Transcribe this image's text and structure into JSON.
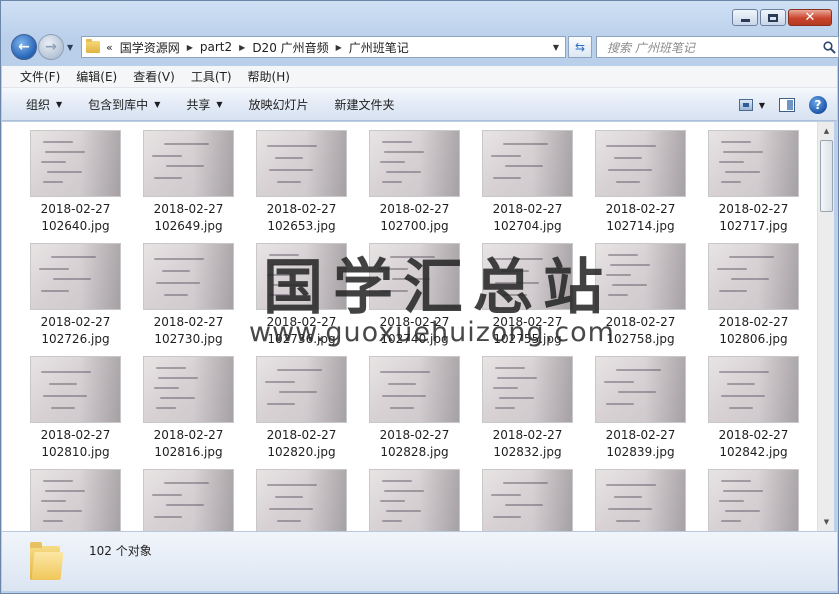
{
  "window": {
    "caption_buttons": [
      "minimize",
      "maximize",
      "close"
    ]
  },
  "nav": {
    "breadcrumbs": [
      "国学资源网",
      "part2",
      "D20 广州音频",
      "广州班笔记"
    ],
    "overflow_glyph": "«",
    "search_placeholder": "搜索 广州班笔记"
  },
  "menu": {
    "items": [
      "文件(F)",
      "编辑(E)",
      "查看(V)",
      "工具(T)",
      "帮助(H)"
    ]
  },
  "commands": {
    "organize": "组织",
    "include_library": "包含到库中",
    "share": "共享",
    "slideshow": "放映幻灯片",
    "new_folder": "新建文件夹"
  },
  "files": [
    {
      "date": "2018-02-27",
      "name": "102640.jpg"
    },
    {
      "date": "2018-02-27",
      "name": "102649.jpg"
    },
    {
      "date": "2018-02-27",
      "name": "102653.jpg"
    },
    {
      "date": "2018-02-27",
      "name": "102700.jpg"
    },
    {
      "date": "2018-02-27",
      "name": "102704.jpg"
    },
    {
      "date": "2018-02-27",
      "name": "102714.jpg"
    },
    {
      "date": "2018-02-27",
      "name": "102717.jpg"
    },
    {
      "date": "2018-02-27",
      "name": "102726.jpg"
    },
    {
      "date": "2018-02-27",
      "name": "102730.jpg"
    },
    {
      "date": "2018-02-27",
      "name": "102736.jpg"
    },
    {
      "date": "2018-02-27",
      "name": "102740.jpg"
    },
    {
      "date": "2018-02-27",
      "name": "102755.jpg"
    },
    {
      "date": "2018-02-27",
      "name": "102758.jpg"
    },
    {
      "date": "2018-02-27",
      "name": "102806.jpg"
    },
    {
      "date": "2018-02-27",
      "name": "102810.jpg"
    },
    {
      "date": "2018-02-27",
      "name": "102816.jpg"
    },
    {
      "date": "2018-02-27",
      "name": "102820.jpg"
    },
    {
      "date": "2018-02-27",
      "name": "102828.jpg"
    },
    {
      "date": "2018-02-27",
      "name": "102832.jpg"
    },
    {
      "date": "2018-02-27",
      "name": "102839.jpg"
    },
    {
      "date": "2018-02-27",
      "name": "102842.jpg"
    },
    {
      "date": "",
      "name": ""
    },
    {
      "date": "",
      "name": ""
    },
    {
      "date": "",
      "name": ""
    },
    {
      "date": "",
      "name": ""
    },
    {
      "date": "",
      "name": ""
    },
    {
      "date": "",
      "name": ""
    },
    {
      "date": "",
      "name": ""
    }
  ],
  "watermark": {
    "cn": "国学汇总站",
    "url": "www.guoxuehuizong.com"
  },
  "status": {
    "count_text": "102 个对象"
  }
}
